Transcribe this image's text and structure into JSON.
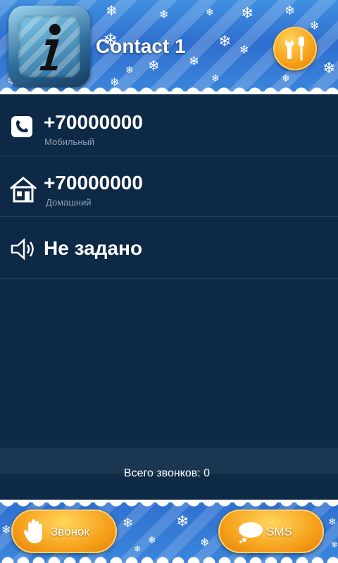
{
  "header": {
    "title": "Contact 1",
    "icon_left": "info-icon",
    "icon_right": "tools-icon"
  },
  "rows": [
    {
      "icon": "phone-icon",
      "value": "+70000000",
      "label": "Мобильный"
    },
    {
      "icon": "house-icon",
      "value": "+70000000",
      "label": "Домашний"
    },
    {
      "icon": "speaker-icon",
      "value": "Не задано"
    }
  ],
  "footer": {
    "total_calls": "Всего звонков: 0",
    "call_button": "Звонок",
    "sms_button": "SMS"
  },
  "colors": {
    "background": "#0e2946",
    "accent_orange": "#f6a11c",
    "header_blue": "#2f6fcf"
  }
}
